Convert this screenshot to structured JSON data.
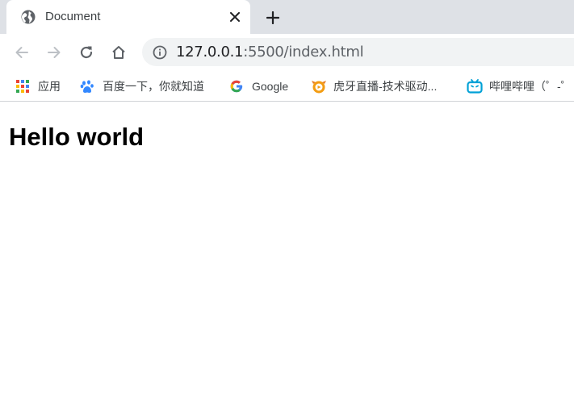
{
  "tab": {
    "title": "Document"
  },
  "omnibox": {
    "url_host": "127.0.0.1",
    "url_rest": ":5500/index.html"
  },
  "bookmarks": [
    {
      "label": "应用",
      "icon": "apps-grid-icon"
    },
    {
      "label": "百度一下，你就知道",
      "icon": "baidu-paw-icon"
    },
    {
      "label": "Google",
      "icon": "google-g-icon"
    },
    {
      "label": "虎牙直播-技术驱动...",
      "icon": "huya-icon"
    },
    {
      "label": "哔哩哔哩（゜-゜",
      "icon": "bilibili-tv-icon"
    }
  ],
  "page": {
    "heading": "Hello world"
  },
  "colors": {
    "tabstrip": "#dee1e6",
    "omnibox": "#f1f3f4",
    "icon": "#5f6368",
    "google_blue": "#4285f4",
    "google_red": "#ea4335",
    "google_yellow": "#fbbc05",
    "google_green": "#34a853",
    "baidu": "#3388ff",
    "huya": "#f39c12",
    "bilibili": "#00a1d6"
  }
}
